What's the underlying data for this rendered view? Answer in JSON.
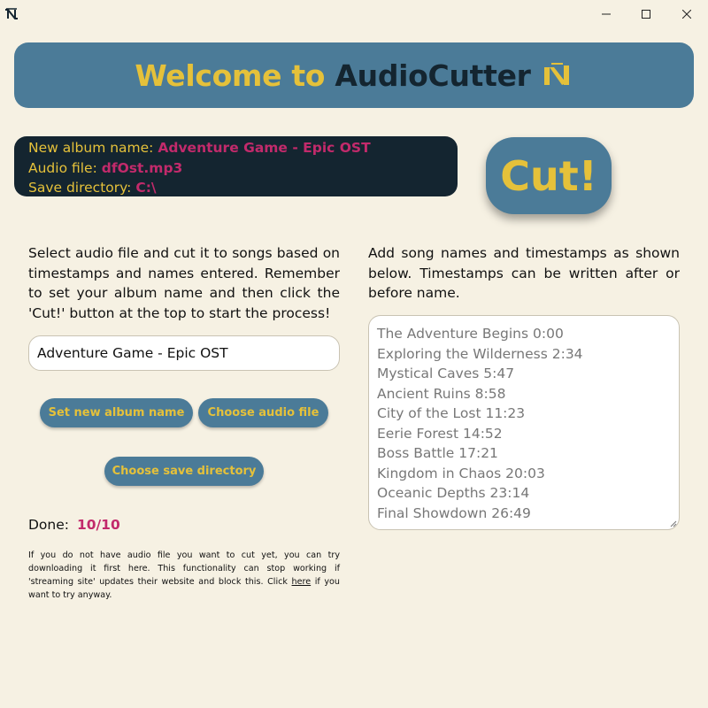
{
  "window": {
    "controls": {
      "minimize": "minimize-icon",
      "maximize": "maximize-icon",
      "close": "close-icon"
    }
  },
  "header": {
    "welcome": "Welcome to",
    "app_name": "AudioCutter",
    "logo": "audiocutter-logo-icon"
  },
  "info": {
    "album_label": "New album name:",
    "album_value": "Adventure Game - Epic OST",
    "audio_label": "Audio file:",
    "audio_value": "dfOst.mp3",
    "save_label": "Save directory:",
    "save_value": "C:\\"
  },
  "cut_button": "Cut!",
  "left_description": "Select audio file and cut it to songs based on timestamps and names entered. Remember to set your album name and then click the 'Cut!' button at the top to start the process!",
  "right_description": "Add song names and timestamps as shown below. Timestamps can be written after or before name.",
  "album_input": {
    "value": "Adventure Game - Epic OST"
  },
  "buttons": {
    "set_album": "Set new album name",
    "choose_audio": "Choose audio file",
    "choose_save": "Choose save directory"
  },
  "progress": {
    "label": "Done:",
    "value": "10/10"
  },
  "note": {
    "before": "If you do not have audio file you want to cut yet, you can try downloading it first here. This functionality can stop working if 'streaming site' updates their website and block this. Click ",
    "link": "here",
    "after": " if you want to try anyway."
  },
  "songs": [
    "The Adventure Begins 0:00",
    "Exploring the Wilderness 2:34",
    "Mystical Caves 5:47",
    "Ancient Ruins 8:58",
    "City of the Lost 11:23",
    "Eerie Forest 14:52",
    "Boss Battle 17:21",
    "Kingdom in Chaos 20:03",
    "Oceanic Depths 23:14",
    "Final Showdown 26:49"
  ],
  "colors": {
    "background": "#f6f1e3",
    "accent_blue": "#4b7b98",
    "accent_yellow": "#e5c13a",
    "dark_navy": "#142530",
    "value_magenta": "#c22a6b"
  }
}
